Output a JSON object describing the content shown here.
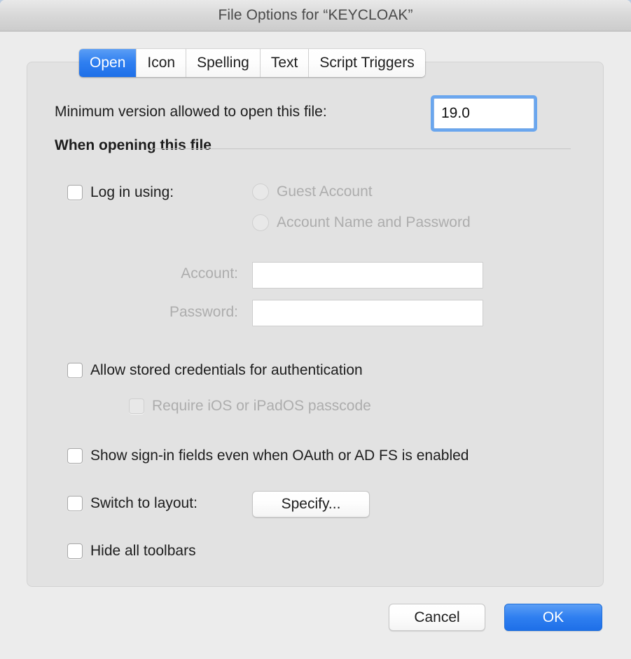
{
  "window": {
    "title": "File Options for “KEYCLOAK”"
  },
  "tabs": [
    {
      "label": "Open",
      "active": true
    },
    {
      "label": "Icon",
      "active": false
    },
    {
      "label": "Spelling",
      "active": false
    },
    {
      "label": "Text",
      "active": false
    },
    {
      "label": "Script Triggers",
      "active": false
    }
  ],
  "open_pane": {
    "minimum_version": {
      "label": "Minimum version allowed to open this file:",
      "value": "19.0"
    },
    "group_label": "When opening this file",
    "log_in_using": {
      "label": "Log in using:",
      "checked": false,
      "options": [
        {
          "label": "Guest Account",
          "selected": false,
          "disabled": true
        },
        {
          "label": "Account Name and Password",
          "selected": false,
          "disabled": true
        }
      ]
    },
    "account": {
      "label": "Account:",
      "value": "",
      "disabled": true
    },
    "password": {
      "label": "Password:",
      "value": "",
      "disabled": true
    },
    "allow_stored_credentials": {
      "label": "Allow stored credentials for authentication",
      "checked": false
    },
    "require_passcode": {
      "label": "Require iOS or iPadOS passcode",
      "checked": false,
      "disabled": true
    },
    "show_signin_fields": {
      "label": "Show sign-in fields even when OAuth or AD FS is enabled",
      "checked": false
    },
    "switch_to_layout": {
      "label": "Switch to layout:",
      "checked": false,
      "button_label": "Specify..."
    },
    "hide_all_toolbars": {
      "label": "Hide all toolbars",
      "checked": false
    }
  },
  "footer": {
    "cancel_label": "Cancel",
    "ok_label": "OK"
  },
  "colors": {
    "accent": "#2f7ff0",
    "window_bg": "#ececec",
    "panel_bg": "#e2e2e2",
    "disabled_text": "#adadad"
  }
}
